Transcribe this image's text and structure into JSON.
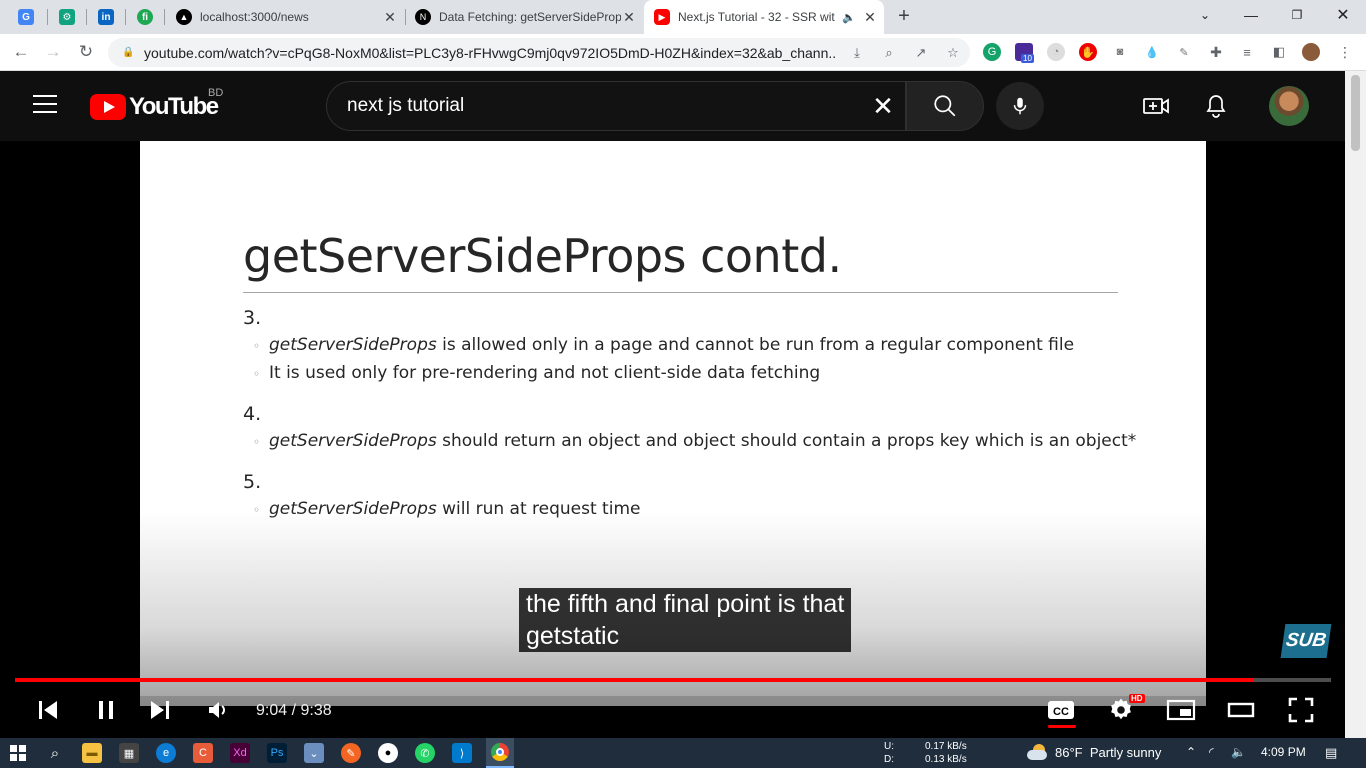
{
  "browser": {
    "tabs": [
      {
        "title": "localhost:3000/news",
        "active": false
      },
      {
        "title": "Data Fetching: getServerSideProp",
        "active": false
      },
      {
        "title": "Next.js Tutorial - 32 - SSR wit",
        "active": true
      }
    ],
    "url": "youtube.com/watch?v=cPqG8-NoxM0&list=PLC3y8-rFHvwgC9mj0qv972IO5DmD-H0ZH&index=32&ab_chann...",
    "extension_badge": "10"
  },
  "youtube": {
    "logo_text": "YouTube",
    "country_code": "BD",
    "search_query": "next js tutorial"
  },
  "slide": {
    "title": "getServerSideProps contd.",
    "points": [
      {
        "number": "3.",
        "bullets": [
          {
            "em": "getServerSideProps",
            "rest": " is allowed only in a page and cannot be run from a regular component file"
          },
          {
            "em": "",
            "rest": "It is used only for pre-rendering and not client-side data fetching"
          }
        ]
      },
      {
        "number": "4.",
        "bullets": [
          {
            "em": "getServerSideProps",
            "rest": " should return an object and object should contain a props key which is an object*"
          }
        ]
      },
      {
        "number": "5.",
        "bullets": [
          {
            "em": "getServerSideProps",
            "rest": " will run at request time"
          }
        ]
      }
    ]
  },
  "caption": {
    "line1": "the fifth and final point is that",
    "line2": "getstatic"
  },
  "sub_badge": "SUB",
  "player": {
    "current_time": "9:04",
    "duration": "9:38",
    "time_display": "9:04 / 9:38",
    "progress_fraction": 0.941,
    "hd_badge": "HD"
  },
  "taskbar": {
    "net_up_label": "U:",
    "net_down_label": "D:",
    "net_up": "0.17 kB/s",
    "net_down": "0.13 kB/s",
    "temperature": "86°F",
    "weather": "Partly sunny",
    "clock": "4:09 PM"
  }
}
